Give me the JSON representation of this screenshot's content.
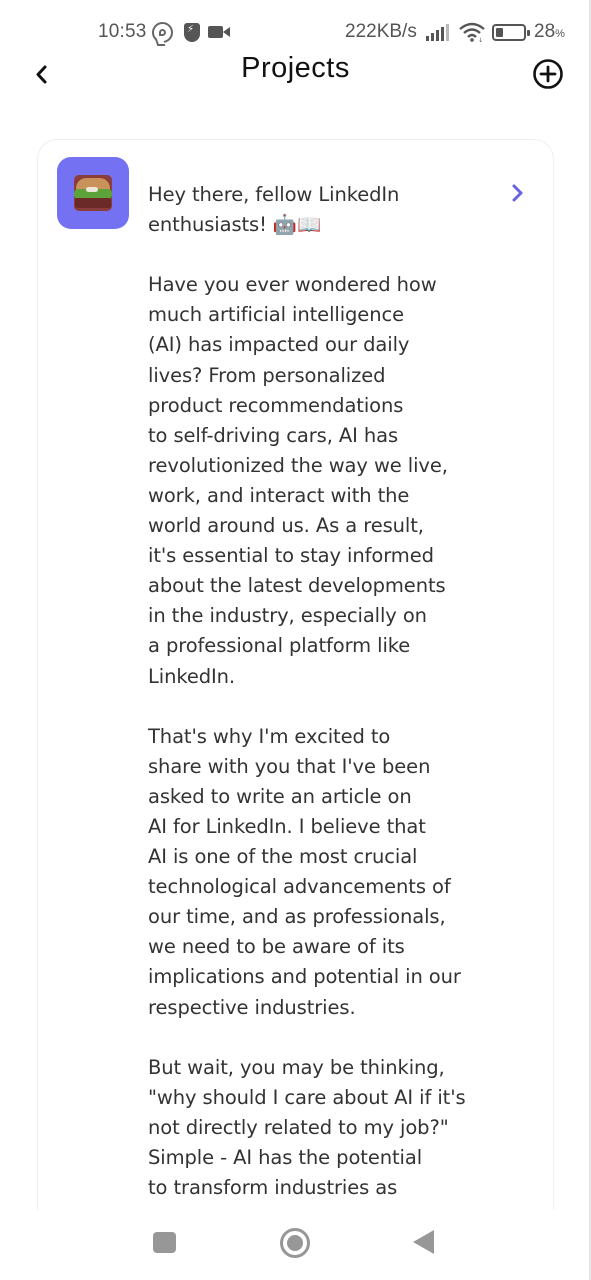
{
  "status_bar": {
    "time": "10:53",
    "network_speed": "222KB/s",
    "battery_percent": "28",
    "battery_percent_symbol": "%",
    "battery_level": 0.28,
    "icons": [
      "viber-icon",
      "shield-bolt-icon",
      "video-camera-icon",
      "signal-icon",
      "wifi-icon",
      "battery-icon"
    ]
  },
  "header": {
    "title": "Projects",
    "back_icon": "chevron-left-icon",
    "add_icon": "plus-circle-icon"
  },
  "project": {
    "icon": "burger-image",
    "icon_bg_color": "#7472f2",
    "accent_color": "#6a63e0",
    "open_icon": "chevron-right-icon",
    "paragraphs": [
      "Hey there, fellow LinkedIn\nenthusiasts! 🤖📖",
      "Have you ever wondered how\nmuch artificial intelligence\n(AI) has impacted our daily\nlives? From personalized\nproduct recommendations\nto self-driving cars, AI has\nrevolutionized the way we live,\nwork, and interact with the\nworld around us. As a result,\nit's essential to stay informed\nabout the latest developments\nin the industry, especially on\na professional platform like\nLinkedIn.",
      "That's why I'm excited to\nshare with you that I've been\nasked to write an article on\nAI for LinkedIn. I believe that\nAI is one of the most crucial\ntechnological advancements of\nour time, and as professionals,\nwe need to be aware of its\nimplications and potential in our\nrespective industries.",
      "But wait, you may be thinking,\n\"why should I care about AI if it's\nnot directly related to my job?\"\nSimple - AI has the potential\nto transform industries as"
    ]
  },
  "nav_bar": {
    "recent_icon": "square-icon",
    "home_icon": "circle-home-icon",
    "back_icon": "triangle-back-icon"
  }
}
